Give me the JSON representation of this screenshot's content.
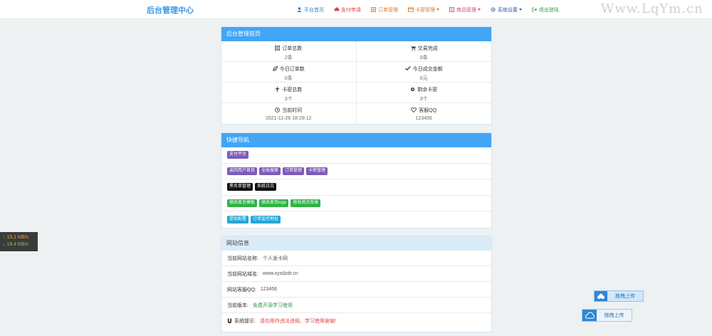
{
  "brand": "后台管理中心",
  "nav": [
    {
      "label": "平台首页",
      "icon": "user-icon",
      "color": "#2f7fc9",
      "caret": false
    },
    {
      "label": "支付申请",
      "icon": "cloud-icon",
      "color": "#e23d3d",
      "caret": false
    },
    {
      "label": "订单管理",
      "icon": "list-icon",
      "color": "#e0771c",
      "caret": false
    },
    {
      "label": "卡密管理",
      "icon": "card-icon",
      "color": "#e0771c",
      "caret": true
    },
    {
      "label": "商品管理",
      "icon": "box-icon",
      "color": "#d44a86",
      "caret": true
    },
    {
      "label": "系统设置",
      "icon": "gear-icon",
      "color": "#2f5f9e",
      "caret": true
    },
    {
      "label": "退出登陆",
      "icon": "logout-icon",
      "color": "#2f9a4c",
      "caret": false
    }
  ],
  "watermark": "Www.LqYm.cn",
  "dashboard": {
    "title": "后台管理首页",
    "stats": [
      {
        "label": "订单总数",
        "value": "2条",
        "icon": "grid-icon"
      },
      {
        "label": "交易完成",
        "value": "0条",
        "icon": "cart-icon"
      },
      {
        "label": "今日订单数",
        "value": "0条",
        "icon": "leaf-icon"
      },
      {
        "label": "今日成交金额",
        "value": "0元",
        "icon": "check-icon"
      },
      {
        "label": "卡密总数",
        "value": "3个",
        "icon": "plane-icon"
      },
      {
        "label": "剩余卡密",
        "value": "3个",
        "icon": "asterisk-icon"
      },
      {
        "label": "当前时间",
        "value": "2021-11-26 18:29:12",
        "icon": "clock-icon"
      },
      {
        "label": "客服QQ",
        "value": "123456",
        "icon": "heart-icon"
      }
    ]
  },
  "quick": {
    "title": "快捷导航",
    "rows": [
      {
        "color": "purple",
        "items": [
          "支付平台"
        ]
      },
      {
        "color": "purple",
        "items": [
          "返回用户首页",
          "全局搜索",
          "订单管理",
          "卡密管理"
        ]
      },
      {
        "color": "black",
        "items": [
          "黑名单管理",
          "系统日志"
        ]
      },
      {
        "color": "green",
        "items": [
          "修改首页模板",
          "修改首页logo",
          "修改首页背景"
        ]
      },
      {
        "color": "cyan",
        "items": [
          "提现配置",
          "订单监控地址"
        ]
      }
    ]
  },
  "site": {
    "title": "网站信息",
    "rows": [
      {
        "label": "当前网站名称:",
        "value": "个人发卡网",
        "style": ""
      },
      {
        "label": "当前网站域名:",
        "value": "www.xysdzdr.cn",
        "style": ""
      },
      {
        "label": "网站客服QQ:",
        "value": "123456",
        "style": ""
      },
      {
        "label": "当前版本:",
        "value": "免费开源学习使用",
        "style": "green"
      },
      {
        "label": "系统提示:",
        "value": "请勿用作违法违规、学习使用谢谢!",
        "style": "red",
        "icon": "magnet-icon"
      }
    ]
  },
  "speed": {
    "up": "↑ 15.1 KB/s",
    "down": "↓ 18.4 KB/s"
  },
  "upload": {
    "label1": "拖拽上传",
    "label2": "拖拽上传"
  }
}
